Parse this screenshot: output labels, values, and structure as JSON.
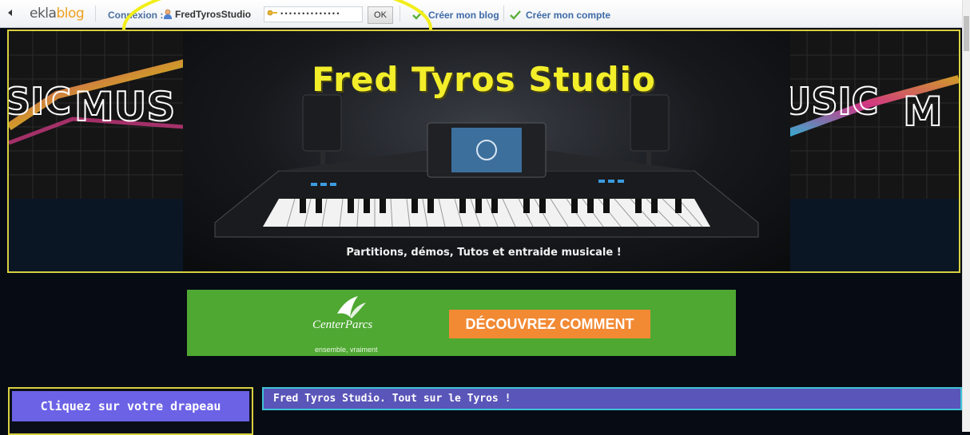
{
  "topbar": {
    "logo_part1": "ekla",
    "logo_part2": "blog",
    "connexion_label": "Connexion :",
    "username": "FredTyrosStudio",
    "password_mask": "••••••••••••••",
    "ok_label": "OK",
    "create_blog": "Créer mon blog",
    "create_account": "Créer mon compte"
  },
  "header": {
    "title": "Fred Tyros Studio",
    "tagline": "Partitions, démos, Tutos et entraide musicale !"
  },
  "ad": {
    "brand": "CenterParcs",
    "slogan": "ensemble, vraiment",
    "cta": "DÉCOUVREZ COMMENT"
  },
  "sidebar": {
    "flag_box_title": "Cliquez sur votre drapeau"
  },
  "main": {
    "post_title": "Fred Tyros Studio. Tout sur le Tyros !"
  },
  "colors": {
    "title_yellow": "#f3ee2a",
    "border_yellow": "#d8d040",
    "ad_green": "#4ea832",
    "cta_orange": "#f28a34",
    "box_purple": "#6b62e6",
    "post_bar": "#5a55b8",
    "post_border": "#3fc2d8",
    "annotation_circle": "#f2ee1a"
  },
  "icons": [
    "back-arrow-icon",
    "user-icon",
    "key-icon",
    "checkmark-icon",
    "keyboard-illustration",
    "music-art-image",
    "leaf-logo-icon"
  ]
}
